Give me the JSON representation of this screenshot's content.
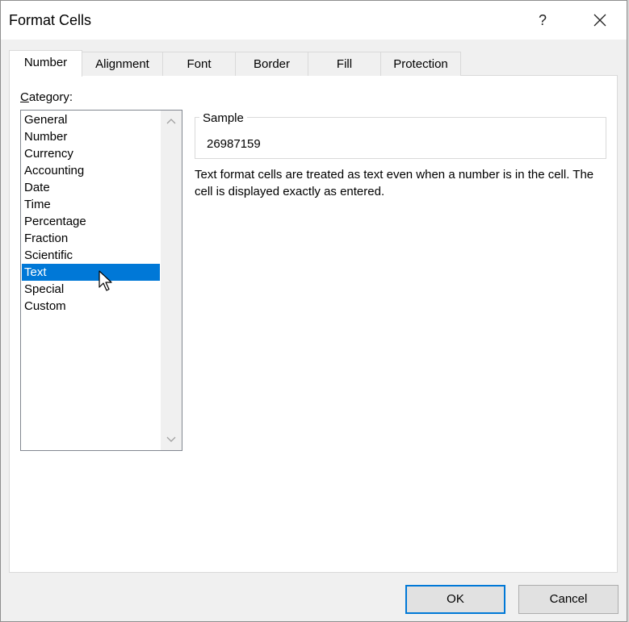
{
  "window": {
    "title": "Format Cells",
    "help_label": "?"
  },
  "tabs": [
    {
      "label": "Number",
      "active": true
    },
    {
      "label": "Alignment",
      "active": false
    },
    {
      "label": "Font",
      "active": false
    },
    {
      "label": "Border",
      "active": false
    },
    {
      "label": "Fill",
      "active": false
    },
    {
      "label": "Protection",
      "active": false
    }
  ],
  "category": {
    "label_prefix": "C",
    "label_rest": "ategory:",
    "items": [
      "General",
      "Number",
      "Currency",
      "Accounting",
      "Date",
      "Time",
      "Percentage",
      "Fraction",
      "Scientific",
      "Text",
      "Special",
      "Custom"
    ],
    "selected": "Text"
  },
  "sample": {
    "legend": "Sample",
    "value": "26987159"
  },
  "description": "Text format cells are treated as text even when a number is in the cell.  The cell is displayed exactly as entered.",
  "buttons": {
    "ok": "OK",
    "cancel": "Cancel"
  },
  "colors": {
    "selection": "#0078d7",
    "dialog_bg": "#f0f0f0",
    "panel_bg": "#ffffff"
  }
}
